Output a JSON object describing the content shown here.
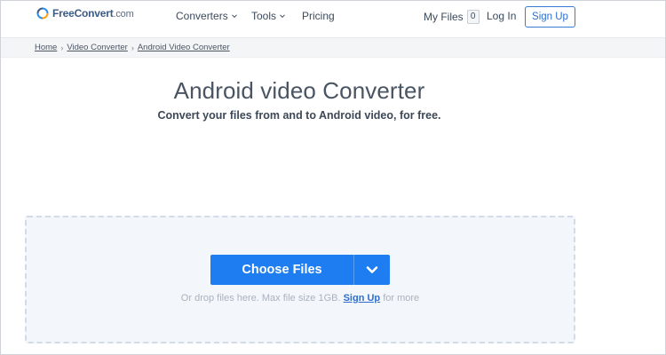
{
  "brand": {
    "logo_free": "Free",
    "logo_convert": "Convert",
    "logo_com": ".com",
    "accent": "#1e7df0"
  },
  "nav": {
    "items": [
      {
        "label": "Converters",
        "has_dropdown": true
      },
      {
        "label": "Tools",
        "has_dropdown": true
      },
      {
        "label": "Pricing",
        "has_dropdown": false
      }
    ],
    "my_files_label": "My Files",
    "my_files_count": "0",
    "login_label": "Log In",
    "signup_label": "Sign Up"
  },
  "breadcrumb": {
    "items": [
      "Home",
      "Video Converter",
      "Android Video Converter"
    ],
    "separator": "›"
  },
  "hero": {
    "title": "Android video Converter",
    "subtitle": "Convert your files from and to Android video, for free."
  },
  "upload": {
    "choose_label": "Choose Files",
    "dropdown_icon": "chevron-down-icon",
    "hint_prefix": "Or drop files here. Max file size 1GB.",
    "hint_link": "Sign Up",
    "hint_suffix": "for more"
  }
}
